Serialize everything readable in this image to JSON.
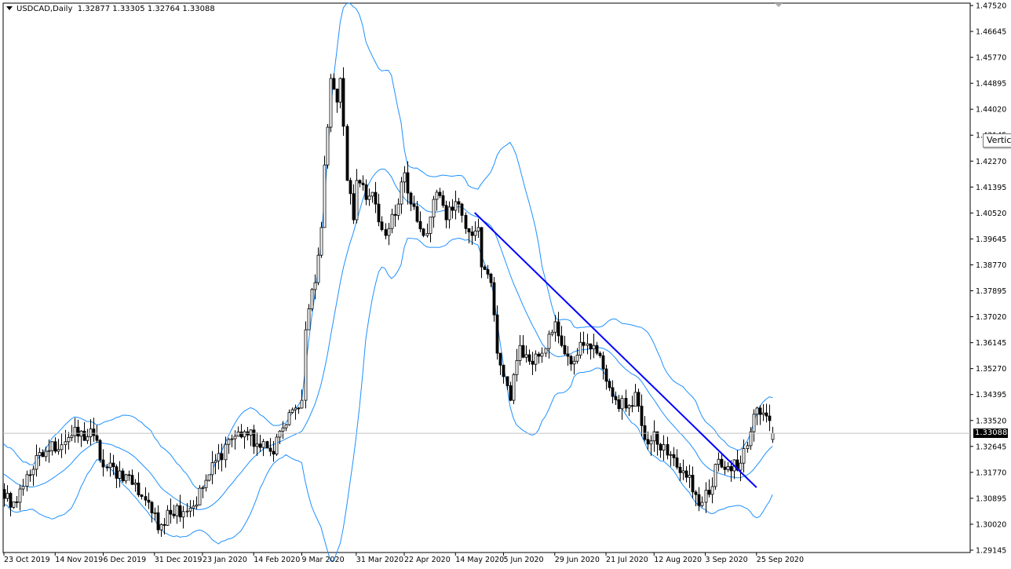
{
  "header": {
    "symbol": "USDCAD,Daily",
    "open": "1.32877",
    "high": "1.33305",
    "low": "1.32764",
    "close": "1.33088"
  },
  "tooltip": "Vertica",
  "chart_data": {
    "type": "candlestick",
    "title": "USDCAD,Daily",
    "ylim": [
      1.29145,
      1.4752
    ],
    "y_ticks": [
      "1.47520",
      "1.46645",
      "1.45770",
      "1.44895",
      "1.44020",
      "1.43145",
      "1.42270",
      "1.41395",
      "1.40520",
      "1.39645",
      "1.38770",
      "1.37895",
      "1.37020",
      "1.36145",
      "1.35270",
      "1.34395",
      "1.33520",
      "1.32645",
      "1.31770",
      "1.30895",
      "1.30020",
      "1.29145"
    ],
    "current_price": "1.33088",
    "bars": 241,
    "x_labels": [
      {
        "bar": 0,
        "label": "23 Oct 2019"
      },
      {
        "bar": 16,
        "label": "14 Nov 2019"
      },
      {
        "bar": 31,
        "label": "6 Dec 2019"
      },
      {
        "bar": 47,
        "label": "31 Dec 2019"
      },
      {
        "bar": 62,
        "label": "23 Jan 2020"
      },
      {
        "bar": 78,
        "label": "14 Feb 2020"
      },
      {
        "bar": 93,
        "label": "9 Mar 2020"
      },
      {
        "bar": 110,
        "label": "31 Mar 2020"
      },
      {
        "bar": 125,
        "label": "22 Apr 2020"
      },
      {
        "bar": 141,
        "label": "14 May 2020"
      },
      {
        "bar": 156,
        "label": "5 Jun 2020"
      },
      {
        "bar": 172,
        "label": "29 Jun 2020"
      },
      {
        "bar": 188,
        "label": "21 Jul 2020"
      },
      {
        "bar": 203,
        "label": "12 Aug 2020"
      },
      {
        "bar": 219,
        "label": "3 Sep 2020"
      },
      {
        "bar": 235,
        "label": "25 Sep 2020"
      }
    ],
    "close_anchors": [
      [
        -20,
        1.325
      ],
      [
        0,
        1.3089
      ],
      [
        4,
        1.3076
      ],
      [
        7,
        1.3169
      ],
      [
        13,
        1.3248
      ],
      [
        21,
        1.3301
      ],
      [
        28,
        1.3301
      ],
      [
        31,
        1.3195
      ],
      [
        38,
        1.3169
      ],
      [
        45,
        1.3076
      ],
      [
        48,
        1.2983
      ],
      [
        51,
        1.3049
      ],
      [
        59,
        1.3063
      ],
      [
        64,
        1.3169
      ],
      [
        70,
        1.3288
      ],
      [
        75,
        1.3314
      ],
      [
        80,
        1.3261
      ],
      [
        83,
        1.3248
      ],
      [
        87,
        1.3327
      ],
      [
        91,
        1.3394
      ],
      [
        93,
        1.342
      ],
      [
        94,
        1.3658
      ],
      [
        97,
        1.3817
      ],
      [
        99,
        1.4003
      ],
      [
        100,
        1.4214
      ],
      [
        102,
        1.4506
      ],
      [
        104,
        1.4426
      ],
      [
        105,
        1.4506
      ],
      [
        107,
        1.4162
      ],
      [
        109,
        1.4029
      ],
      [
        110,
        1.4162
      ],
      [
        114,
        1.4109
      ],
      [
        116,
        1.4082
      ],
      [
        119,
        1.3976
      ],
      [
        123,
        1.4082
      ],
      [
        125,
        1.4188
      ],
      [
        127,
        1.4082
      ],
      [
        131,
        1.3976
      ],
      [
        135,
        1.4122
      ],
      [
        138,
        1.4029
      ],
      [
        142,
        1.4082
      ],
      [
        146,
        1.3976
      ],
      [
        148,
        1.4003
      ],
      [
        149,
        1.387
      ],
      [
        152,
        1.3817
      ],
      [
        154,
        1.3579
      ],
      [
        156,
        1.35
      ],
      [
        158,
        1.342
      ],
      [
        161,
        1.3605
      ],
      [
        164,
        1.3552
      ],
      [
        168,
        1.3579
      ],
      [
        172,
        1.3685
      ],
      [
        174,
        1.3605
      ],
      [
        178,
        1.3552
      ],
      [
        181,
        1.3605
      ],
      [
        185,
        1.3579
      ],
      [
        187,
        1.3526
      ],
      [
        190,
        1.3433
      ],
      [
        194,
        1.3394
      ],
      [
        197,
        1.3447
      ],
      [
        200,
        1.3288
      ],
      [
        203,
        1.3314
      ],
      [
        207,
        1.3235
      ],
      [
        212,
        1.3182
      ],
      [
        216,
        1.3102
      ],
      [
        218,
        1.3076
      ],
      [
        221,
        1.3129
      ],
      [
        223,
        1.3221
      ],
      [
        227,
        1.3182
      ],
      [
        230,
        1.3208
      ],
      [
        233,
        1.3314
      ],
      [
        235,
        1.3394
      ],
      [
        238,
        1.3367
      ],
      [
        240,
        1.33088
      ]
    ],
    "indicator": {
      "name": "Bollinger Bands",
      "period": 20,
      "deviations": 2,
      "color": "#1e90ff"
    },
    "trendline": {
      "from": [
        147,
        1.4053
      ],
      "to": [
        235,
        1.3126
      ],
      "color": "#0000ff"
    },
    "colors": {
      "bull_body": "#ffffff",
      "bear_body": "#000000",
      "outline": "#000000",
      "price_line": "#c0c0c0"
    }
  }
}
